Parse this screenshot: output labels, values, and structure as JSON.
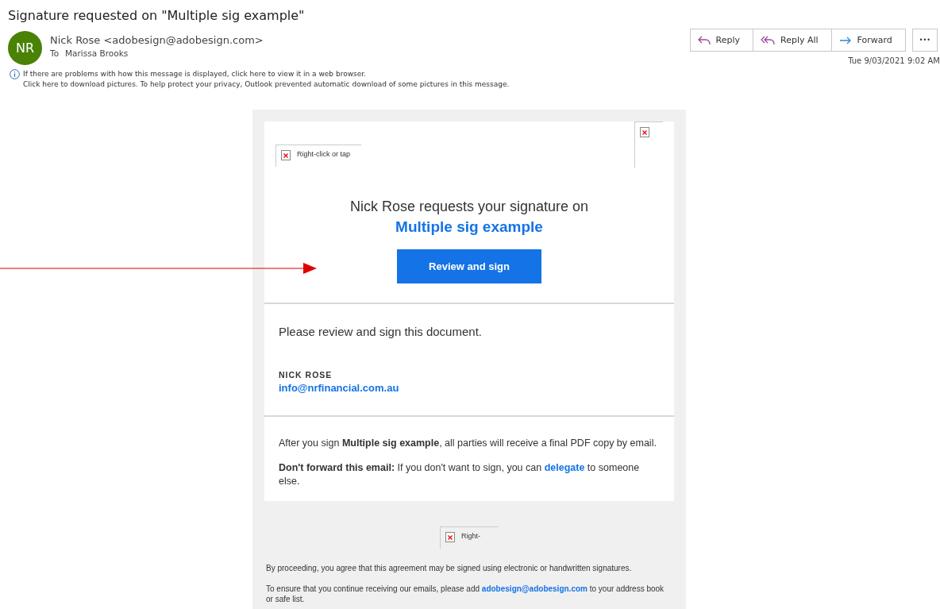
{
  "subject": "Signature requested on \"Multiple sig example\"",
  "sender": {
    "initials": "NR",
    "name": "Nick Rose <adobesign@adobesign.com>",
    "to_label": "To",
    "to": "Marissa Brooks"
  },
  "actions": [
    {
      "kind": "reply",
      "label": "Reply"
    },
    {
      "kind": "reply_all",
      "label": "Reply All"
    },
    {
      "kind": "forward",
      "label": "Forward"
    },
    {
      "kind": "more",
      "label": "•••"
    }
  ],
  "date": "Tue 9/03/2021 9:02 AM",
  "info_lines": [
    "If there are problems with how this message is displayed, click here to view it in a web browser.",
    "Click here to download pictures. To help protect your privacy, Outlook prevented automatic download of some pictures in this message."
  ],
  "email": {
    "logo_image": {
      "text": "Right-click or tap"
    },
    "corner_image": {
      "kind": "broken_image"
    },
    "heading": "Nick Rose requests your signature on",
    "document": "Multiple sig example",
    "button": "Review and sign",
    "message": "Please review and sign this document.",
    "signer_name": "NICK ROSE",
    "signer_email": "info@nrfinancial.com.au",
    "notice": "After you sign **Multiple sig example**, all parties will receive a final PDF copy by email.",
    "forward_note": {
      "bold": "Don't forward this email:",
      "before": " If you don't want to sign, you can ",
      "link": "delegate",
      "after": " to someone else."
    },
    "footer_image": {
      "text": "Right-"
    },
    "footer_lines": [
      {
        "before": "By proceeding, you agree that this agreement may be signed using electronic or handwritten signatures."
      },
      {
        "before": "To ensure that you continue receiving our emails, please add ",
        "link": "adobesign@adobesign.com",
        "after": " to your address book or safe list."
      }
    ]
  }
}
